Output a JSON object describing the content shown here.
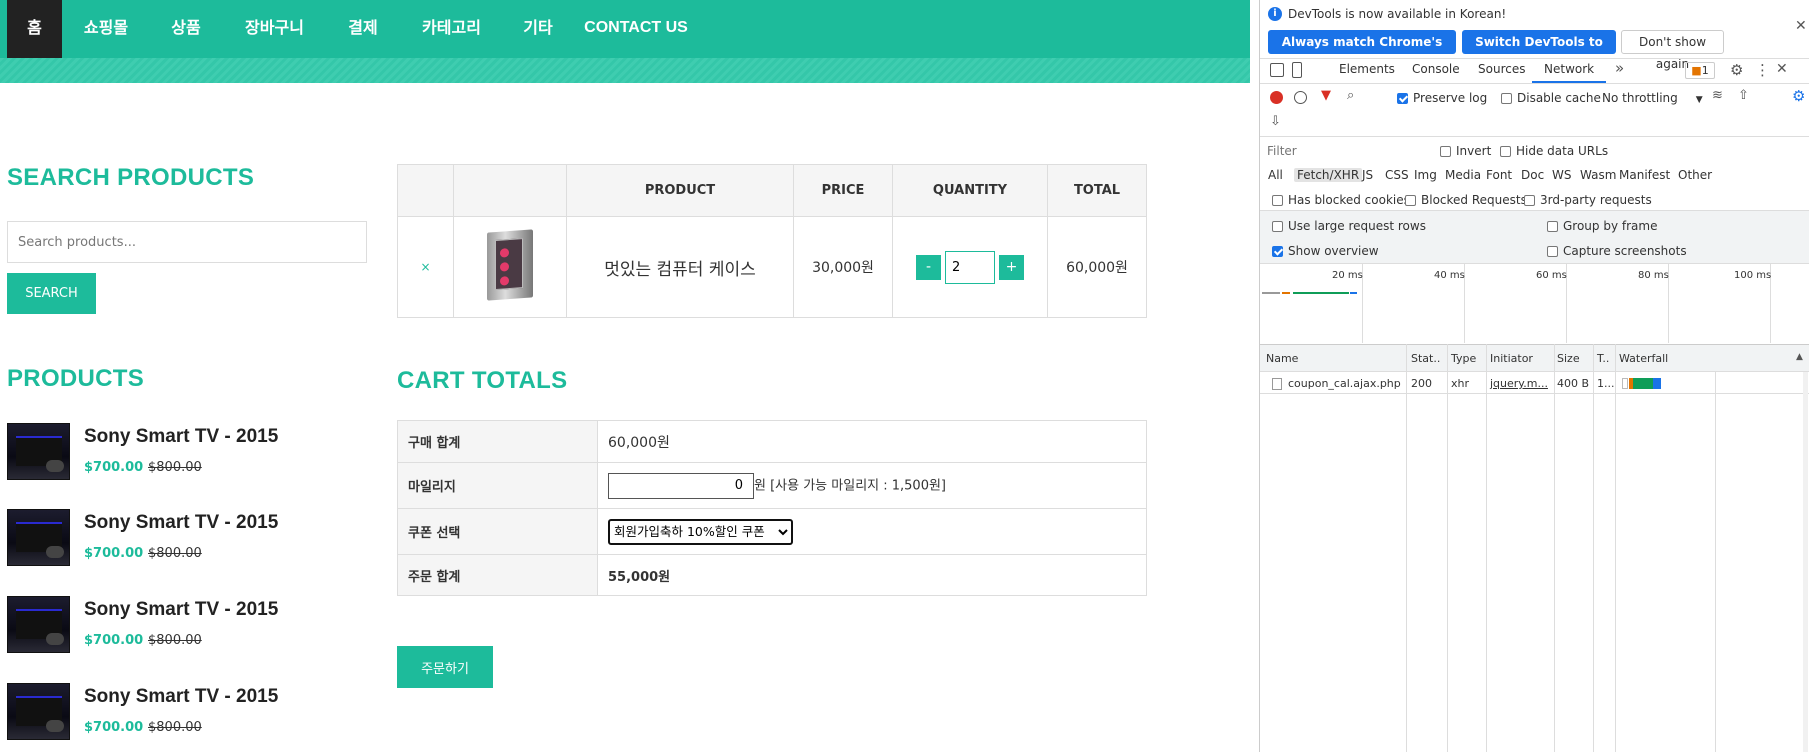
{
  "nav": {
    "items": [
      "홈",
      "쇼핑몰",
      "상품",
      "장바구니",
      "결제",
      "카테고리",
      "기타",
      "CONTACT US"
    ]
  },
  "sidebar": {
    "search_title": "SEARCH PRODUCTS",
    "search_placeholder": "Search products...",
    "search_button": "SEARCH",
    "products_title": "PRODUCTS",
    "products": [
      {
        "name": "Sony Smart TV - 2015",
        "price": "$700.00",
        "old_price": "$800.00"
      },
      {
        "name": "Sony Smart TV - 2015",
        "price": "$700.00",
        "old_price": "$800.00"
      },
      {
        "name": "Sony Smart TV - 2015",
        "price": "$700.00",
        "old_price": "$800.00"
      },
      {
        "name": "Sony Smart TV - 2015",
        "price": "$700.00",
        "old_price": "$800.00"
      }
    ]
  },
  "cart": {
    "headers": {
      "product": "PRODUCT",
      "price": "PRICE",
      "quantity": "QUANTITY",
      "total": "TOTAL"
    },
    "row": {
      "remove": "×",
      "name": "멋있는 컴퓨터 케이스",
      "price": "30,000원",
      "qty_minus": "-",
      "qty": "2",
      "qty_plus": "+",
      "total": "60,000원"
    }
  },
  "totals": {
    "title": "CART TOTALS",
    "subtotal_label": "구매 합계",
    "subtotal": "60,000원",
    "mileage_label": "마일리지",
    "mileage_value": "0",
    "mileage_note": "원 [사용 가능 마일리지 : 1,500원]",
    "coupon_label": "쿠폰 선택",
    "coupon_selected": "회원가입축하 10%할인 쿠폰",
    "order_total_label": "주문 합계",
    "order_total": "55,000원",
    "order_button": "주문하기"
  },
  "devtools": {
    "info_message": "DevTools is now available in Korean!",
    "btn_match": "Always match Chrome's language",
    "btn_switch": "Switch DevTools to Korean",
    "btn_dont_show": "Don't show again",
    "tabs": [
      "Elements",
      "Console",
      "Sources",
      "Network"
    ],
    "active_tab": "Network",
    "more_tabs": "»",
    "issues_count": "1",
    "toolbar": {
      "preserve_log": "Preserve log",
      "disable_cache": "Disable cache",
      "throttling": "No throttling"
    },
    "filter": {
      "placeholder": "Filter",
      "invert": "Invert",
      "hide_data_urls": "Hide data URLs"
    },
    "types": [
      "All",
      "Fetch/XHR",
      "JS",
      "CSS",
      "Img",
      "Media",
      "Font",
      "Doc",
      "WS",
      "Wasm",
      "Manifest",
      "Other"
    ],
    "active_type": "Fetch/XHR",
    "options": {
      "blocked_cookies": "Has blocked cookies",
      "blocked_requests": "Blocked Requests",
      "third_party": "3rd-party requests",
      "large_rows": "Use large request rows",
      "group_by_frame": "Group by frame",
      "show_overview": "Show overview",
      "capture_screenshots": "Capture screenshots"
    },
    "timeline": [
      "20 ms",
      "40 ms",
      "60 ms",
      "80 ms",
      "100 ms"
    ],
    "columns": [
      "Name",
      "Stat..",
      "Type",
      "Initiator",
      "Size",
      "T..",
      "Waterfall"
    ],
    "requests": [
      {
        "name": "coupon_cal.ajax.php",
        "status": "200",
        "type": "xhr",
        "initiator": "jquery.m...",
        "size": "400 B",
        "time": "1..."
      }
    ],
    "colors": {
      "accent": "#1a73e8",
      "record": "#d93025"
    }
  },
  "colors": {
    "brand": "#1dbb9b",
    "nav_active": "#222222"
  }
}
